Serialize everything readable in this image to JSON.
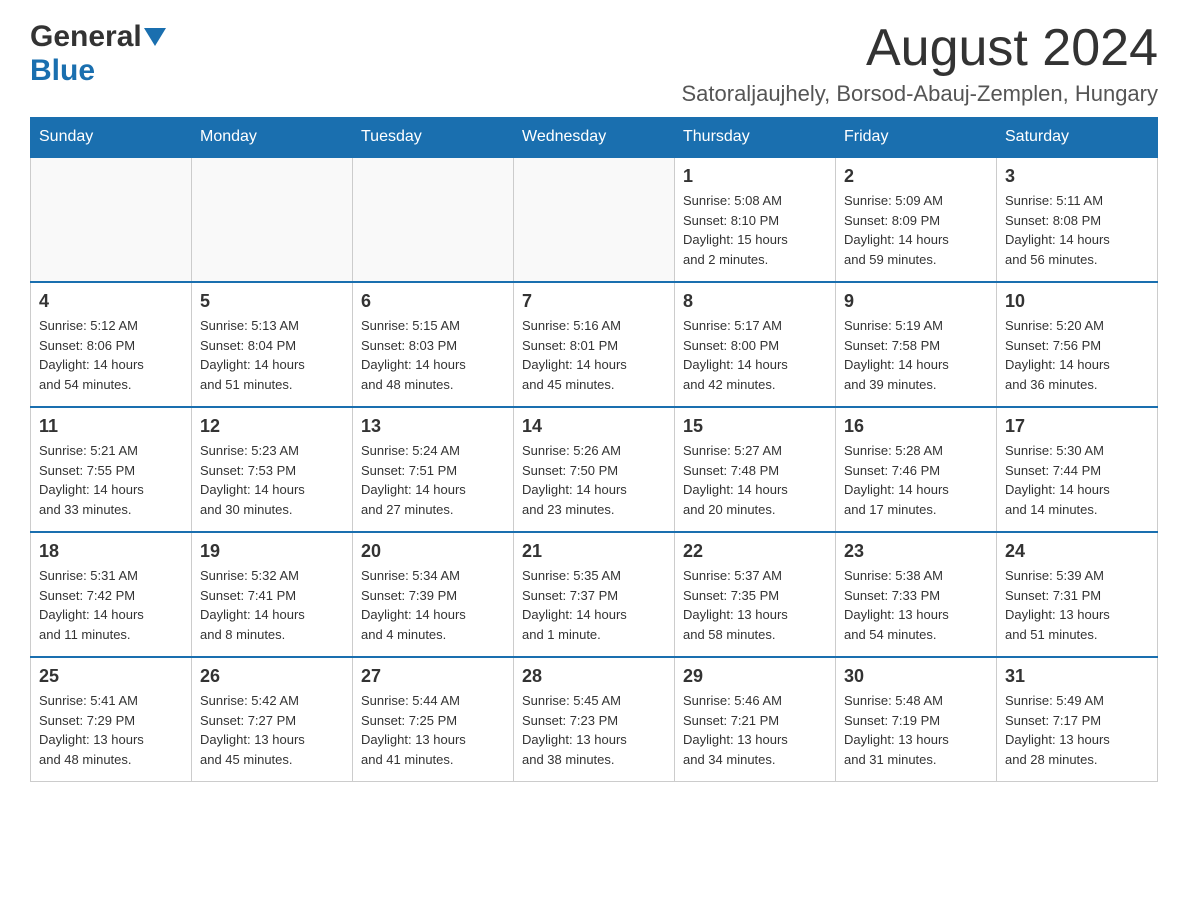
{
  "logo": {
    "general": "General",
    "blue": "Blue"
  },
  "title": "August 2024",
  "subtitle": "Satoraljaujhely, Borsod-Abauj-Zemplen, Hungary",
  "weekdays": [
    "Sunday",
    "Monday",
    "Tuesday",
    "Wednesday",
    "Thursday",
    "Friday",
    "Saturday"
  ],
  "weeks": [
    [
      {
        "day": "",
        "info": ""
      },
      {
        "day": "",
        "info": ""
      },
      {
        "day": "",
        "info": ""
      },
      {
        "day": "",
        "info": ""
      },
      {
        "day": "1",
        "info": "Sunrise: 5:08 AM\nSunset: 8:10 PM\nDaylight: 15 hours\nand 2 minutes."
      },
      {
        "day": "2",
        "info": "Sunrise: 5:09 AM\nSunset: 8:09 PM\nDaylight: 14 hours\nand 59 minutes."
      },
      {
        "day": "3",
        "info": "Sunrise: 5:11 AM\nSunset: 8:08 PM\nDaylight: 14 hours\nand 56 minutes."
      }
    ],
    [
      {
        "day": "4",
        "info": "Sunrise: 5:12 AM\nSunset: 8:06 PM\nDaylight: 14 hours\nand 54 minutes."
      },
      {
        "day": "5",
        "info": "Sunrise: 5:13 AM\nSunset: 8:04 PM\nDaylight: 14 hours\nand 51 minutes."
      },
      {
        "day": "6",
        "info": "Sunrise: 5:15 AM\nSunset: 8:03 PM\nDaylight: 14 hours\nand 48 minutes."
      },
      {
        "day": "7",
        "info": "Sunrise: 5:16 AM\nSunset: 8:01 PM\nDaylight: 14 hours\nand 45 minutes."
      },
      {
        "day": "8",
        "info": "Sunrise: 5:17 AM\nSunset: 8:00 PM\nDaylight: 14 hours\nand 42 minutes."
      },
      {
        "day": "9",
        "info": "Sunrise: 5:19 AM\nSunset: 7:58 PM\nDaylight: 14 hours\nand 39 minutes."
      },
      {
        "day": "10",
        "info": "Sunrise: 5:20 AM\nSunset: 7:56 PM\nDaylight: 14 hours\nand 36 minutes."
      }
    ],
    [
      {
        "day": "11",
        "info": "Sunrise: 5:21 AM\nSunset: 7:55 PM\nDaylight: 14 hours\nand 33 minutes."
      },
      {
        "day": "12",
        "info": "Sunrise: 5:23 AM\nSunset: 7:53 PM\nDaylight: 14 hours\nand 30 minutes."
      },
      {
        "day": "13",
        "info": "Sunrise: 5:24 AM\nSunset: 7:51 PM\nDaylight: 14 hours\nand 27 minutes."
      },
      {
        "day": "14",
        "info": "Sunrise: 5:26 AM\nSunset: 7:50 PM\nDaylight: 14 hours\nand 23 minutes."
      },
      {
        "day": "15",
        "info": "Sunrise: 5:27 AM\nSunset: 7:48 PM\nDaylight: 14 hours\nand 20 minutes."
      },
      {
        "day": "16",
        "info": "Sunrise: 5:28 AM\nSunset: 7:46 PM\nDaylight: 14 hours\nand 17 minutes."
      },
      {
        "day": "17",
        "info": "Sunrise: 5:30 AM\nSunset: 7:44 PM\nDaylight: 14 hours\nand 14 minutes."
      }
    ],
    [
      {
        "day": "18",
        "info": "Sunrise: 5:31 AM\nSunset: 7:42 PM\nDaylight: 14 hours\nand 11 minutes."
      },
      {
        "day": "19",
        "info": "Sunrise: 5:32 AM\nSunset: 7:41 PM\nDaylight: 14 hours\nand 8 minutes."
      },
      {
        "day": "20",
        "info": "Sunrise: 5:34 AM\nSunset: 7:39 PM\nDaylight: 14 hours\nand 4 minutes."
      },
      {
        "day": "21",
        "info": "Sunrise: 5:35 AM\nSunset: 7:37 PM\nDaylight: 14 hours\nand 1 minute."
      },
      {
        "day": "22",
        "info": "Sunrise: 5:37 AM\nSunset: 7:35 PM\nDaylight: 13 hours\nand 58 minutes."
      },
      {
        "day": "23",
        "info": "Sunrise: 5:38 AM\nSunset: 7:33 PM\nDaylight: 13 hours\nand 54 minutes."
      },
      {
        "day": "24",
        "info": "Sunrise: 5:39 AM\nSunset: 7:31 PM\nDaylight: 13 hours\nand 51 minutes."
      }
    ],
    [
      {
        "day": "25",
        "info": "Sunrise: 5:41 AM\nSunset: 7:29 PM\nDaylight: 13 hours\nand 48 minutes."
      },
      {
        "day": "26",
        "info": "Sunrise: 5:42 AM\nSunset: 7:27 PM\nDaylight: 13 hours\nand 45 minutes."
      },
      {
        "day": "27",
        "info": "Sunrise: 5:44 AM\nSunset: 7:25 PM\nDaylight: 13 hours\nand 41 minutes."
      },
      {
        "day": "28",
        "info": "Sunrise: 5:45 AM\nSunset: 7:23 PM\nDaylight: 13 hours\nand 38 minutes."
      },
      {
        "day": "29",
        "info": "Sunrise: 5:46 AM\nSunset: 7:21 PM\nDaylight: 13 hours\nand 34 minutes."
      },
      {
        "day": "30",
        "info": "Sunrise: 5:48 AM\nSunset: 7:19 PM\nDaylight: 13 hours\nand 31 minutes."
      },
      {
        "day": "31",
        "info": "Sunrise: 5:49 AM\nSunset: 7:17 PM\nDaylight: 13 hours\nand 28 minutes."
      }
    ]
  ]
}
